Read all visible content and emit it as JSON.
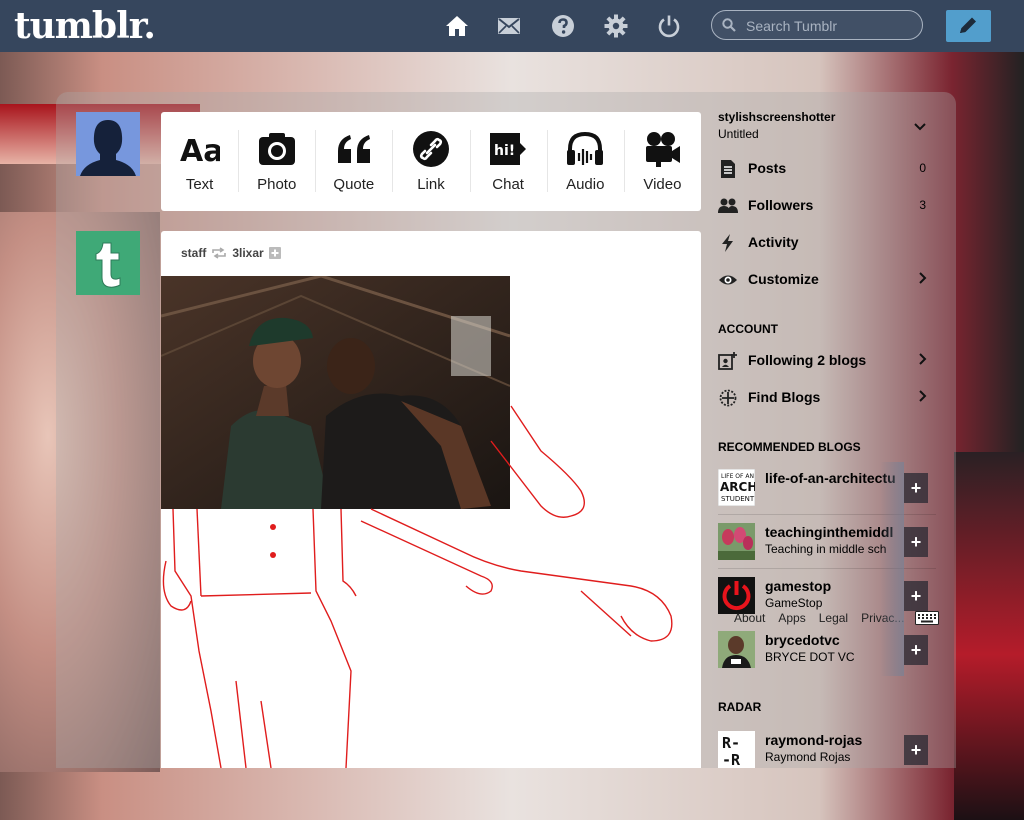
{
  "header": {
    "logo": "tumblr.",
    "search_placeholder": "Search Tumblr",
    "nav_icons": [
      "home-icon",
      "mail-icon",
      "help-icon",
      "settings-icon",
      "power-icon"
    ],
    "accent_color": "#36465d",
    "compose_color": "#529ecc"
  },
  "post_types": [
    {
      "label": "Text",
      "icon": "text-icon"
    },
    {
      "label": "Photo",
      "icon": "camera-icon"
    },
    {
      "label": "Quote",
      "icon": "quote-icon"
    },
    {
      "label": "Link",
      "icon": "link-icon"
    },
    {
      "label": "Chat",
      "icon": "chat-icon"
    },
    {
      "label": "Audio",
      "icon": "headphones-icon"
    },
    {
      "label": "Video",
      "icon": "video-camera-icon"
    }
  ],
  "post": {
    "author": "staff",
    "reblogged_from": "3lixar"
  },
  "sidebar": {
    "blog_name": "stylishscreenshotter",
    "blog_title": "Untitled",
    "items": [
      {
        "label": "Posts",
        "count": "0"
      },
      {
        "label": "Followers",
        "count": "3"
      },
      {
        "label": "Activity"
      },
      {
        "label": "Customize"
      }
    ],
    "account_heading": "ACCOUNT",
    "account_items": [
      {
        "label": "Following 2 blogs"
      },
      {
        "label": "Find Blogs"
      }
    ],
    "recommended_heading": "RECOMMENDED BLOGS",
    "recommended": [
      {
        "name": "life-of-an-architectu",
        "title": "",
        "thumb_text": "LIFE OF AN ARCHI STUDENT"
      },
      {
        "name": "teachinginthemiddl",
        "title": "Teaching in middle sch"
      },
      {
        "name": "gamestop",
        "title": "GameStop"
      },
      {
        "name": "brycedotvc",
        "title": "BRYCE DOT VC"
      }
    ],
    "footer_links": [
      "About",
      "Apps",
      "Legal",
      "Privac..."
    ],
    "radar_heading": "RADAR",
    "radar": {
      "name": "raymond-rojas",
      "title": "Raymond Rojas",
      "thumb_text": "R-R"
    },
    "add_label": "+"
  }
}
